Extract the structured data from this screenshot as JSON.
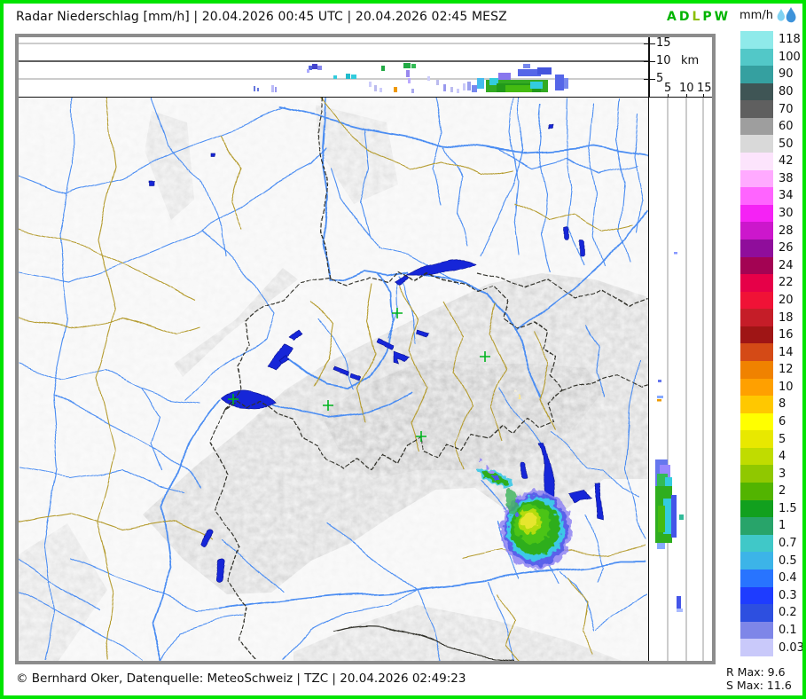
{
  "title_bar": {
    "title": "Radar Niederschlag [mm/h] | 20.04.2026 00:45 UTC | 20.04.2026 02:45 MESZ",
    "stations": [
      {
        "letter": "A",
        "color": "#00b400"
      },
      {
        "letter": "D",
        "color": "#00b400"
      },
      {
        "letter": "L",
        "color": "#8cbe00"
      },
      {
        "letter": "P",
        "color": "#00b400"
      },
      {
        "letter": "W",
        "color": "#00b400"
      }
    ],
    "unit": "mm/h",
    "drops_icon": {
      "light": "#7fd2f2",
      "dark": "#3e93da"
    }
  },
  "axes": {
    "altitude_ticks": [
      "15",
      "10",
      "5"
    ],
    "altitude_unit": "km",
    "distance_ticks": [
      "5",
      "10",
      "15"
    ]
  },
  "legend": {
    "entries": [
      {
        "label": "118",
        "color": "#8feaea"
      },
      {
        "label": "100",
        "color": "#52c8c8"
      },
      {
        "label": "90",
        "color": "#35a0a0"
      },
      {
        "label": "80",
        "color": "#3f5555"
      },
      {
        "label": "70",
        "color": "#5f5f5f"
      },
      {
        "label": "60",
        "color": "#9e9e9e"
      },
      {
        "label": "50",
        "color": "#d9d9d9"
      },
      {
        "label": "42",
        "color": "#fce4fc"
      },
      {
        "label": "38",
        "color": "#ffaaff"
      },
      {
        "label": "34",
        "color": "#ff64ff"
      },
      {
        "label": "30",
        "color": "#f522f5"
      },
      {
        "label": "28",
        "color": "#cc17cc"
      },
      {
        "label": "26",
        "color": "#8f0d9b"
      },
      {
        "label": "24",
        "color": "#a30353"
      },
      {
        "label": "22",
        "color": "#e60048"
      },
      {
        "label": "20",
        "color": "#f01236"
      },
      {
        "label": "18",
        "color": "#c51d28"
      },
      {
        "label": "16",
        "color": "#9f1515"
      },
      {
        "label": "14",
        "color": "#d44a16"
      },
      {
        "label": "12",
        "color": "#f08200"
      },
      {
        "label": "10",
        "color": "#ffa000"
      },
      {
        "label": "8",
        "color": "#ffc800"
      },
      {
        "label": "6",
        "color": "#ffff00"
      },
      {
        "label": "5",
        "color": "#e8e800"
      },
      {
        "label": "4",
        "color": "#c0dc00"
      },
      {
        "label": "3",
        "color": "#90c800"
      },
      {
        "label": "2",
        "color": "#52b400"
      },
      {
        "label": "1.5",
        "color": "#12a01e"
      },
      {
        "label": "1",
        "color": "#28a46a"
      },
      {
        "label": "0.7",
        "color": "#40c8c8"
      },
      {
        "label": "0.5",
        "color": "#3cb4e8"
      },
      {
        "label": "0.4",
        "color": "#2874ff"
      },
      {
        "label": "0.3",
        "color": "#1e3cff"
      },
      {
        "label": "0.2",
        "color": "#2d4fe0"
      },
      {
        "label": "0.1",
        "color": "#7e86e8"
      },
      {
        "label": "0.03",
        "color": "#c9c9fa"
      }
    ]
  },
  "stats": {
    "r_max": "R Max: 9.6",
    "s_max": "S Max: 11.6"
  },
  "footer": {
    "copyright": "© Bernhard Oker, Datenquelle: MeteoSchweiz | TZC | 20.04.2026 02:49:23"
  }
}
